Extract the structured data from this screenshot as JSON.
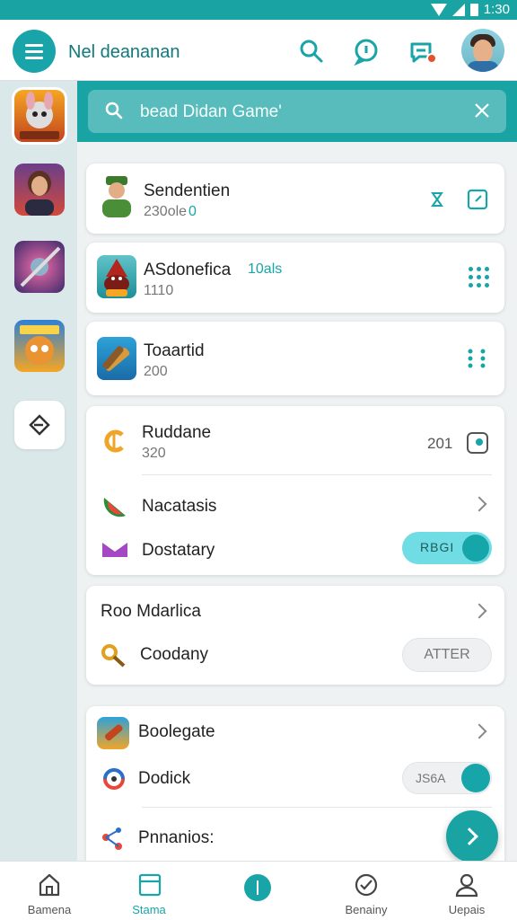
{
  "status_bar": {
    "time": "1:30"
  },
  "header": {
    "title": "Nel deananan",
    "icons": [
      "menu-icon",
      "search-icon",
      "chat-icon",
      "notification-icon",
      "avatar"
    ]
  },
  "search": {
    "placeholder": "bead Didan Game'"
  },
  "sidebar": {
    "items": [
      "game-tile-1",
      "game-tile-2",
      "game-tile-3",
      "game-tile-4",
      "rotate-icon"
    ]
  },
  "cards": {
    "c1": {
      "title": "Sendentien",
      "sub": "230ole",
      "sub_badge": "0"
    },
    "c2": {
      "title": "ASdonefica",
      "badge": "10als",
      "sub": "1110"
    },
    "c3": {
      "title": "Toaartid",
      "sub": "200"
    },
    "c4": {
      "r1": {
        "title": "Ruddane",
        "sub": "320",
        "value": "201"
      },
      "r2": {
        "title": "Nacatasis"
      },
      "r3": {
        "title": "Dostatary",
        "toggle_label": "RBGI"
      }
    },
    "c5": {
      "r1": {
        "title": "Roo Mdarlica"
      },
      "r2": {
        "title": "Coodany",
        "button": "ATTER"
      }
    },
    "c6": {
      "r1": {
        "title": "Boolegate"
      },
      "r2": {
        "title": "Dodick",
        "toggle_label": "JS6A"
      },
      "r3": {
        "title": "Pnnanios:"
      }
    }
  },
  "bottom_nav": {
    "items": [
      {
        "label": "Bamena"
      },
      {
        "label": "Stama"
      },
      {
        "label": ""
      },
      {
        "label": "Benainy"
      },
      {
        "label": "Uepais"
      }
    ]
  },
  "colors": {
    "accent": "#1aa3a3",
    "accent_dark": "#11797d",
    "toggle_on": "#6fdde3"
  }
}
